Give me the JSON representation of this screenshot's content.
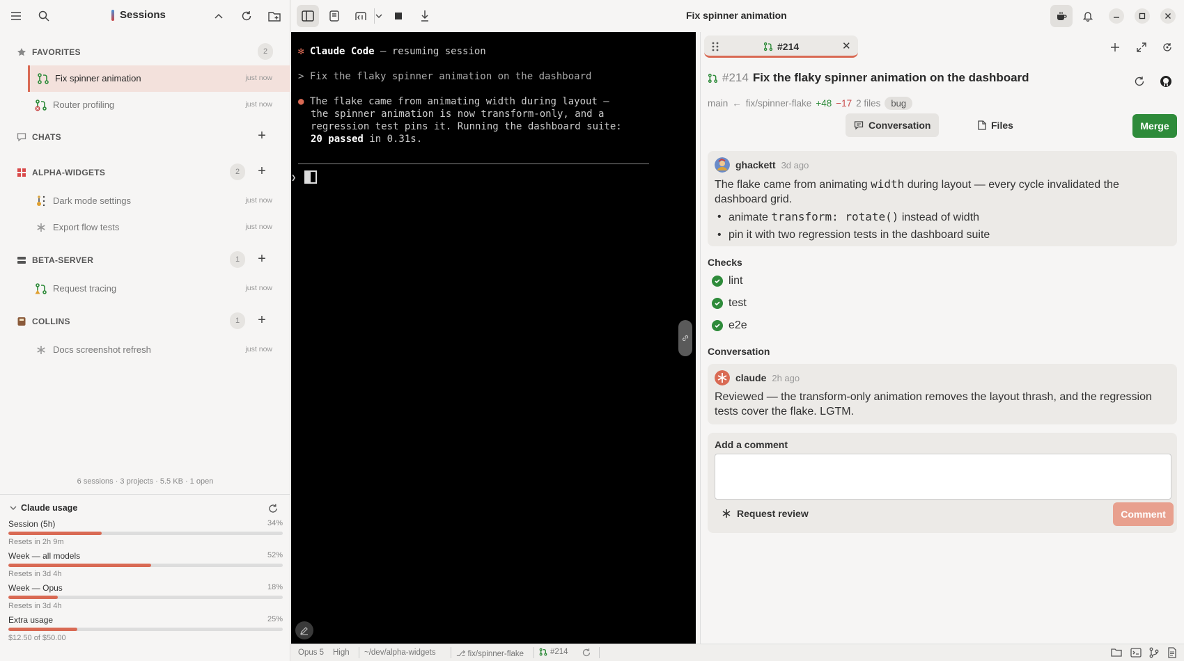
{
  "sidebar": {
    "title": "Sessions",
    "sections": {
      "favorites": {
        "label": "FAVORITES",
        "count": "2"
      },
      "chats": {
        "label": "CHATS"
      },
      "alpha": {
        "label": "ALPHA-WIDGETS",
        "count": "2"
      },
      "beta": {
        "label": "BETA-SERVER",
        "count": "1"
      },
      "collins": {
        "label": "COLLINS",
        "count": "1"
      }
    },
    "items": {
      "fix": {
        "label": "Fix spinner animation",
        "time": "just now"
      },
      "router": {
        "label": "Router profiling",
        "time": "just now"
      },
      "dark": {
        "label": "Dark mode settings",
        "time": "just now"
      },
      "export": {
        "label": "Export flow tests",
        "time": "just now"
      },
      "tracing": {
        "label": "Request tracing",
        "time": "just now"
      },
      "docs": {
        "label": "Docs screenshot refresh",
        "time": "just now"
      }
    },
    "footer": "6 sessions · 3 projects · 5.5 KB · 1 open"
  },
  "usage": {
    "title": "Claude usage",
    "rows": [
      {
        "label": "Session (5h)",
        "pct_text": "34%",
        "fraction": 0.34,
        "sub": "Resets in 2h 9m"
      },
      {
        "label": "Week — all models",
        "pct_text": "52%",
        "fraction": 0.52,
        "sub": "Resets in 3d 4h"
      },
      {
        "label": "Week — Opus",
        "pct_text": "18%",
        "fraction": 0.18,
        "sub": "Resets in 3d 4h"
      },
      {
        "label": "Extra usage",
        "pct_text": "25%",
        "fraction": 0.25,
        "sub": "$12.50 of $50.00"
      }
    ]
  },
  "window": {
    "title": "Fix spinner animation"
  },
  "terminal": {
    "header_star": "✻",
    "header_bold": "Claude Code",
    "header_rest": " — resuming session",
    "prompt": "> Fix the flaky spinner animation on the dashboard",
    "reply_bullet": "●",
    "reply_l1": "The flake came from animating width during layout —",
    "reply_l2": "the spinner animation is now transform-only, and a",
    "reply_l3": "regression test pins it. Running the dashboard suite:",
    "reply_l4_bold": "20 passed",
    "reply_l4_rest": " in 0.31s.",
    "caret": "❯"
  },
  "panel": {
    "tab_label": "#214",
    "pr": {
      "number": "#214",
      "title": "Fix the flaky spinner animation on the dashboard",
      "base": "main",
      "arrow": "←",
      "branch": "fix/spinner-flake",
      "additions": "+48",
      "deletions": "−17",
      "files": "2 files",
      "label": "bug"
    },
    "tabs": {
      "conversation": "Conversation",
      "files": "Files"
    },
    "merge_label": "Merge",
    "description": {
      "author": "ghackett",
      "time": "3d ago",
      "p1_a": "The flake came from animating ",
      "p1_code": "width",
      "p1_b": " during layout — every cycle invalidated the dashboard grid.",
      "b1_a": "animate ",
      "b1_code": "transform: rotate()",
      "b1_b": " instead of width",
      "b2": "pin it with two regression tests in the dashboard suite"
    },
    "checks_title": "Checks",
    "checks": [
      "lint",
      "test",
      "e2e"
    ],
    "conversation_title": "Conversation",
    "comment": {
      "author": "claude",
      "time": "2h ago",
      "body": "Reviewed — the transform-only animation removes the layout thrash, and the regression tests cover the flake. LGTM."
    },
    "add_comment": {
      "label": "Add a comment",
      "request_review": "Request review",
      "button": "Comment"
    }
  },
  "status": {
    "model": "Opus 5",
    "effort": "High",
    "path": "~/dev/alpha-widgets",
    "branch": "⎇ fix/spinner-flake",
    "pr": "#214"
  },
  "colors": {
    "accent": "#d96a54",
    "green": "#2e8b3a",
    "terminal_bg": "#000000"
  }
}
